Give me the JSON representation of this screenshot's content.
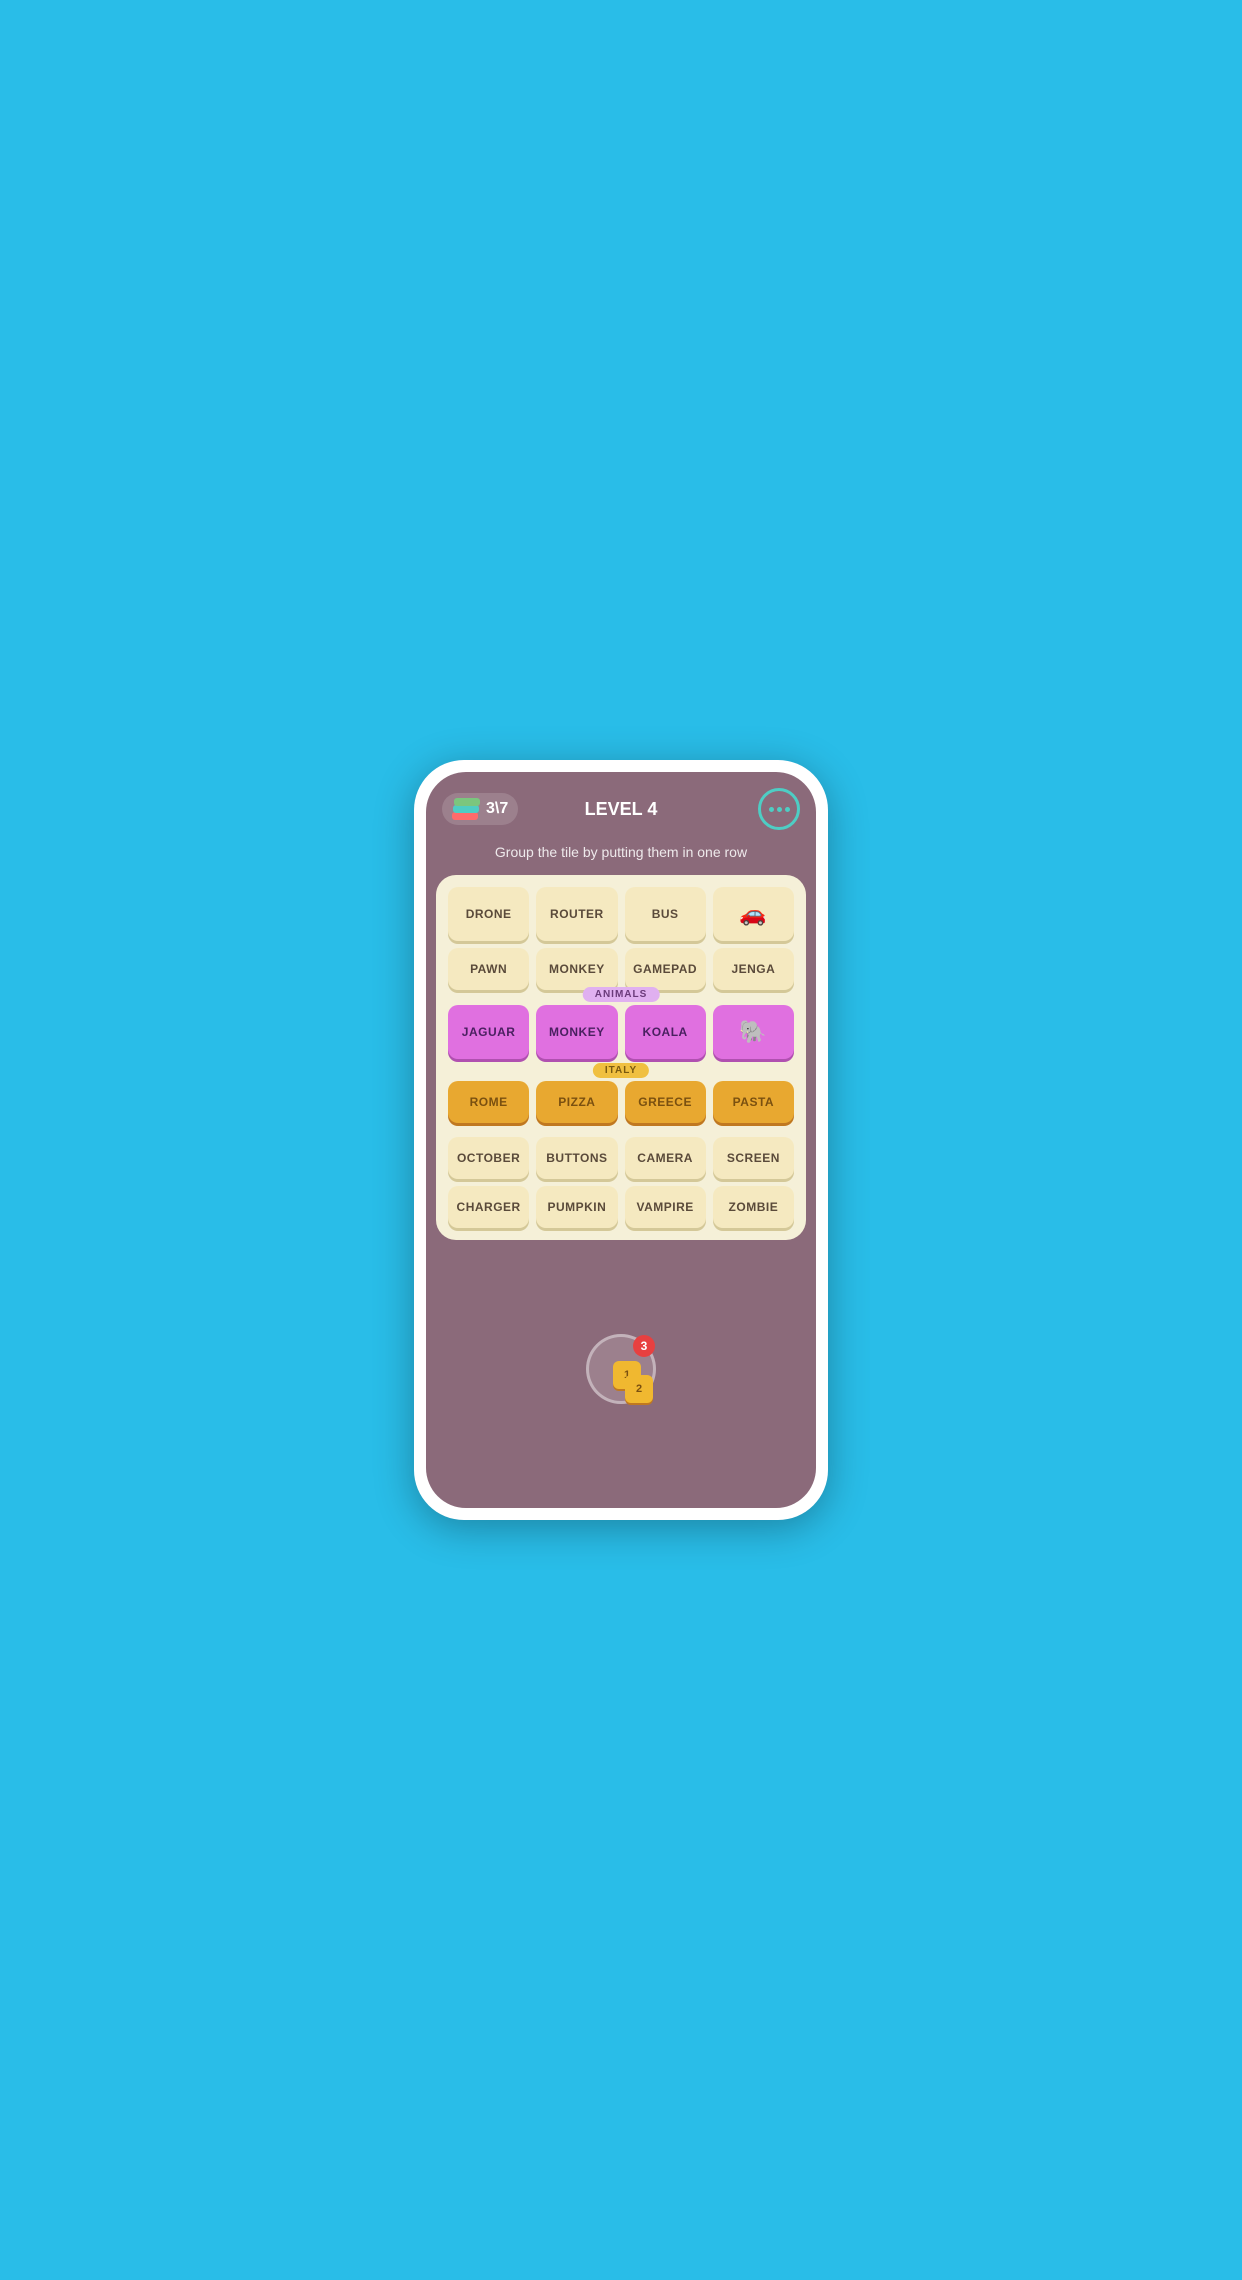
{
  "header": {
    "score": "3\\7",
    "level_label": "LEVEL 4",
    "menu_dots": "...",
    "instruction": "Group the tile by putting them in one row"
  },
  "rows": [
    {
      "id": "row1",
      "type": "normal",
      "tiles": [
        {
          "id": "drone",
          "label": "DRONE",
          "icon": false
        },
        {
          "id": "router",
          "label": "ROUTER",
          "icon": false
        },
        {
          "id": "bus",
          "label": "BUS",
          "icon": false
        },
        {
          "id": "car",
          "label": "",
          "icon": true,
          "icon_type": "car"
        }
      ]
    },
    {
      "id": "row2",
      "type": "normal",
      "tiles": [
        {
          "id": "pawn",
          "label": "PAWN",
          "icon": false
        },
        {
          "id": "monkey2",
          "label": "MONKEY",
          "icon": false
        },
        {
          "id": "gamepad",
          "label": "GAMEPAD",
          "icon": false
        },
        {
          "id": "jenga",
          "label": "JENGA",
          "icon": false
        }
      ]
    },
    {
      "id": "row3",
      "type": "animals",
      "group_label": "ANIMALS",
      "tiles": [
        {
          "id": "jaguar",
          "label": "JAGUAR",
          "icon": false
        },
        {
          "id": "monkey",
          "label": "MONKEY",
          "icon": false
        },
        {
          "id": "koala",
          "label": "KOALA",
          "icon": false
        },
        {
          "id": "elephant",
          "label": "",
          "icon": true,
          "icon_type": "elephant"
        }
      ]
    },
    {
      "id": "row4",
      "type": "italy",
      "group_label": "ITALY",
      "tiles": [
        {
          "id": "rome",
          "label": "ROME",
          "icon": false
        },
        {
          "id": "pizza",
          "label": "PIZZA",
          "icon": false
        },
        {
          "id": "greece",
          "label": "GREECE",
          "icon": false
        },
        {
          "id": "pasta",
          "label": "PASTA",
          "icon": false
        }
      ]
    },
    {
      "id": "row5",
      "type": "normal",
      "tiles": [
        {
          "id": "october",
          "label": "OCTOBER",
          "icon": false
        },
        {
          "id": "buttons",
          "label": "BUTTONS",
          "icon": false
        },
        {
          "id": "camera",
          "label": "CAMERA",
          "icon": false
        },
        {
          "id": "screen",
          "label": "SCREEN",
          "icon": false
        }
      ]
    },
    {
      "id": "row6",
      "type": "normal",
      "tiles": [
        {
          "id": "charger",
          "label": "CHARGER",
          "icon": false
        },
        {
          "id": "pumpkin",
          "label": "PUMPKIN",
          "icon": false
        },
        {
          "id": "vampire",
          "label": "VAMPIRE",
          "icon": false
        },
        {
          "id": "zombie",
          "label": "ZOMBIE",
          "icon": false
        }
      ]
    }
  ],
  "hint": {
    "tile1_label": "1",
    "tile2_label": "2",
    "badge_count": "3"
  }
}
